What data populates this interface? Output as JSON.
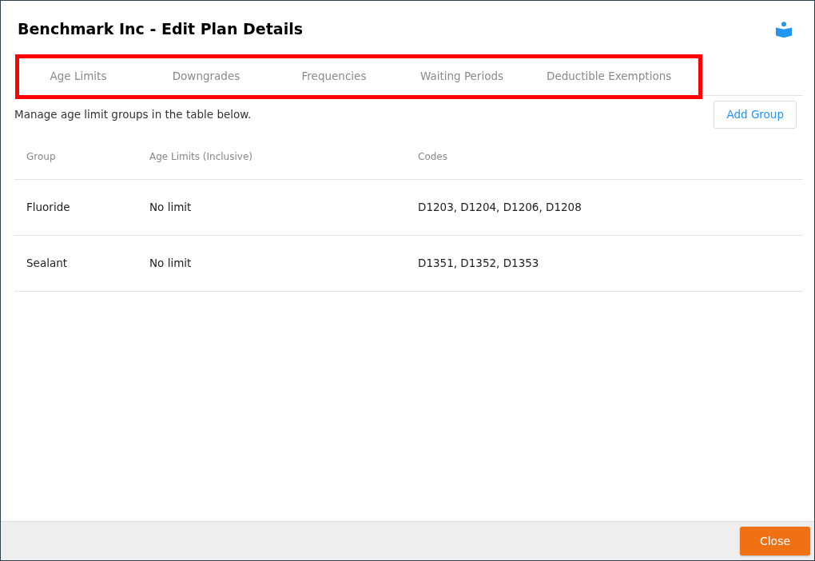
{
  "dialog": {
    "title": "Benchmark Inc - Edit Plan Details"
  },
  "tabs": [
    {
      "label": "Age Limits"
    },
    {
      "label": "Downgrades"
    },
    {
      "label": "Frequencies"
    },
    {
      "label": "Waiting Periods"
    },
    {
      "label": "Deductible Exemptions"
    }
  ],
  "tabs_highlighted": true,
  "description": "Manage age limit groups in the table below.",
  "add_button": "Add Group",
  "table": {
    "columns": [
      "Group",
      "Age Limits (Inclusive)",
      "Codes"
    ],
    "rows": [
      [
        "Fluoride",
        "No limit",
        "D1203, D1204, D1206, D1208"
      ],
      [
        "Sealant",
        "No limit",
        "D1351, D1352, D1353"
      ]
    ]
  },
  "footer": {
    "buttons": [
      "Close"
    ]
  }
}
